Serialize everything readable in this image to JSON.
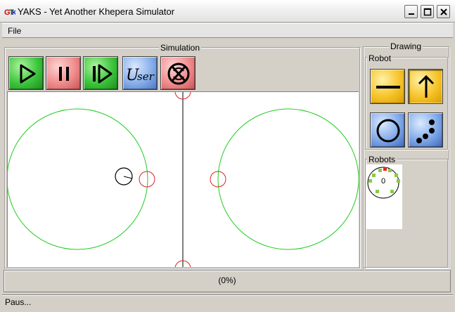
{
  "window": {
    "title": "YAKS - Yet Another Khepera Simulator"
  },
  "menu": {
    "file": "File"
  },
  "simulation": {
    "caption": "Simulation",
    "tools": [
      {
        "name": "play",
        "icon": "play-icon"
      },
      {
        "name": "pause",
        "icon": "pause-icon"
      },
      {
        "name": "step",
        "icon": "step-icon"
      },
      {
        "name": "user",
        "icon": "user-text-icon",
        "label": "User"
      },
      {
        "name": "reset",
        "icon": "reset-icon"
      }
    ]
  },
  "drawing": {
    "caption": "Drawing",
    "robot_caption": "Robot",
    "robots_caption": "Robots",
    "robot_id": "0"
  },
  "progress": {
    "text": "(0%)"
  },
  "status": {
    "text": "Paus..."
  },
  "colors": {
    "circle": "#22cc22",
    "obstacle": "#dd2222",
    "face": "#d4d0c8"
  }
}
